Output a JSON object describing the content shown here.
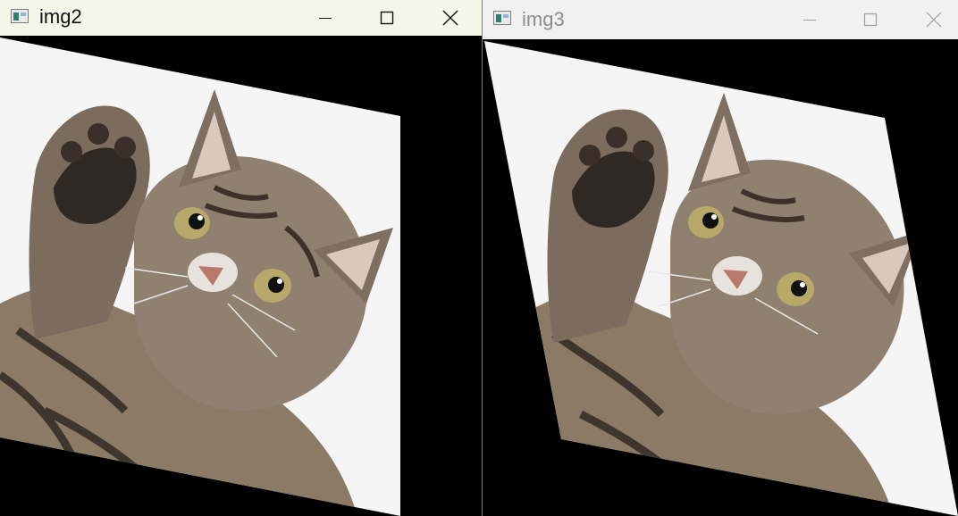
{
  "windows": [
    {
      "title": "img2",
      "active": true,
      "controls": [
        "minimize-icon",
        "maximize-icon",
        "close-icon"
      ]
    },
    {
      "title": "img3",
      "active": false,
      "controls": [
        "minimize-icon",
        "maximize-icon",
        "close-icon"
      ]
    }
  ],
  "colors": {
    "active_titlebar": "#f4f6e8",
    "inactive_titlebar": "#f1f1f1",
    "image_bg": "#000000",
    "canvas": "#f5f5f5"
  }
}
